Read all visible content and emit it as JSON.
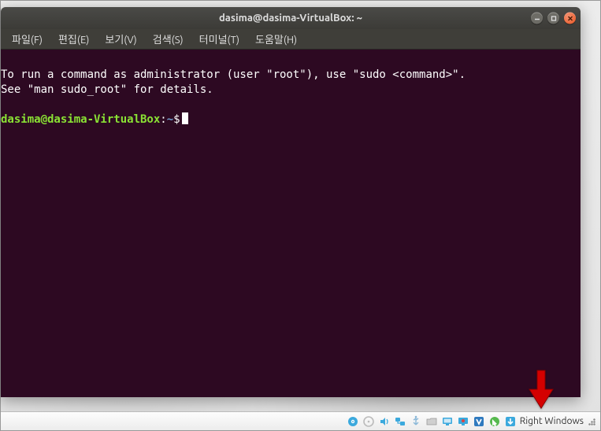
{
  "window": {
    "title": "dasima@dasima-VirtualBox: ~"
  },
  "menus": {
    "file": "파일(F)",
    "edit": "편집(E)",
    "view": "보기(V)",
    "search": "검색(S)",
    "terminal": "터미널(T)",
    "help": "도움말(H)"
  },
  "terminal": {
    "line1": "To run a command as administrator (user \"root\"), use \"sudo <command>\".",
    "line2": "See \"man sudo_root\" for details.",
    "prompt": {
      "userhost": "dasima@dasima-VirtualBox",
      "colon": ":",
      "path": "~",
      "symbol": "$"
    }
  },
  "statusbar": {
    "hostkey": "Right Windows"
  },
  "icons": {
    "hdd": "hard-disk-icon",
    "cd": "cd-icon",
    "audio": "audio-icon",
    "network": "network-icon",
    "usb": "usb-icon",
    "folder": "shared-folder-icon",
    "display": "display-icon",
    "record": "record-icon",
    "vbox": "vbox-icon",
    "mouse": "mouse-integration-icon",
    "hostkey": "hostkey-down-icon"
  }
}
